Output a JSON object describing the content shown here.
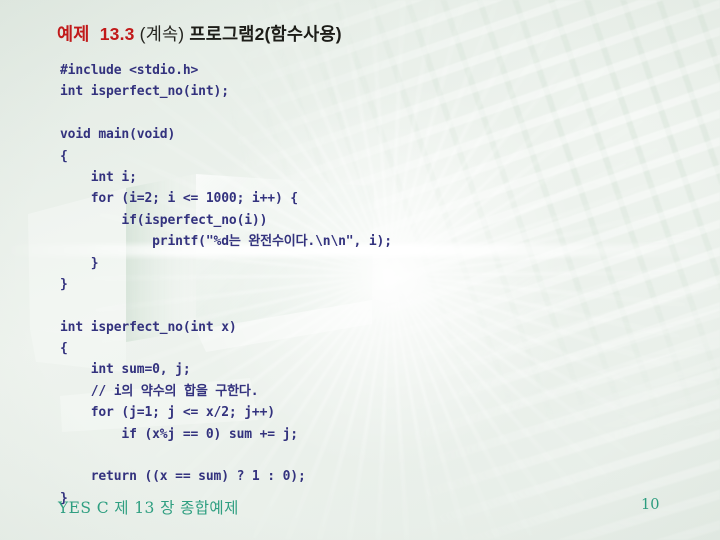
{
  "slide": {
    "title": {
      "example_label": "예제",
      "example_number": "13.3",
      "continued": "(계속)",
      "subject": "프로그램2(함수사용)"
    },
    "code_lines": [
      "#include <stdio.h>",
      "int isperfect_no(int);",
      "",
      "void main(void)",
      "{",
      "    int i;",
      "    for (i=2; i <= 1000; i++) {",
      "        if(isperfect_no(i))",
      "            printf(\"%d는 완전수이다.\\n\\n\", i);",
      "    }",
      "}",
      "",
      "int isperfect_no(int x)",
      "{",
      "    int sum=0, j;",
      "    // i의 약수의 합을 구한다.",
      "    for (j=1; j <= x/2; j++)",
      "        if (x%j == 0) sum += j;",
      "",
      "    return ((x == sum) ? 1 : 0);",
      "}"
    ],
    "footer": "YES C  제 13 장 종합예제",
    "page_number": "10"
  }
}
